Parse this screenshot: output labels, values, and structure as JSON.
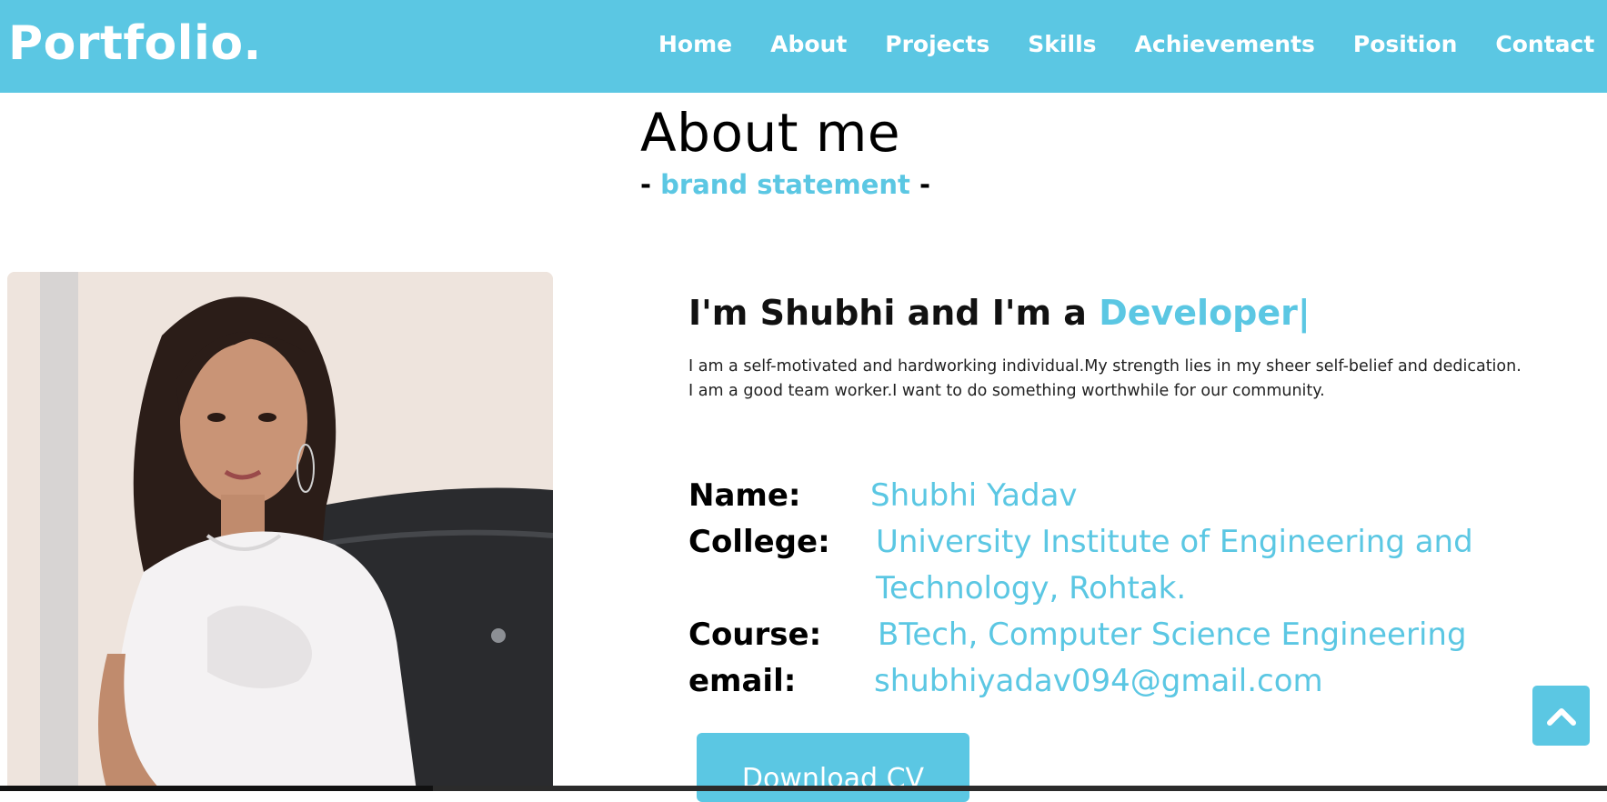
{
  "navbar": {
    "logo": "Portfolio.",
    "links": [
      "Home",
      "About",
      "Projects",
      "Skills",
      "Achievements",
      "Position",
      "Contact"
    ]
  },
  "about": {
    "title": "About me",
    "subtitle_prefix": "- ",
    "subtitle_accent": "brand statement",
    "subtitle_suffix": " -",
    "intro_prefix": "I'm Shubhi and I'm a ",
    "intro_role": "Developer|",
    "bio_line1": "I am a self-motivated and hardworking individual.My strength lies in my sheer self-belief and dedication.",
    "bio_line2": "I am a good team worker.I want to do something worthwhile for our community.",
    "info": {
      "name_label": "Name:",
      "name_value": "Shubhi Yadav",
      "college_label": "College:",
      "college_value_line1": "University Institute of Engineering and",
      "college_value_line2": "Technology, Rohtak.",
      "course_label": "Course:",
      "course_value": "BTech, Computer Science Engineering",
      "email_label": "email:",
      "email_value": "shubhiyadav094@gmail.com"
    },
    "cv_button": "Download CV"
  },
  "colors": {
    "accent": "#5bc7e3",
    "text": "#000000",
    "background": "#ffffff"
  },
  "icons": {
    "to_top": "chevron-up-icon"
  }
}
